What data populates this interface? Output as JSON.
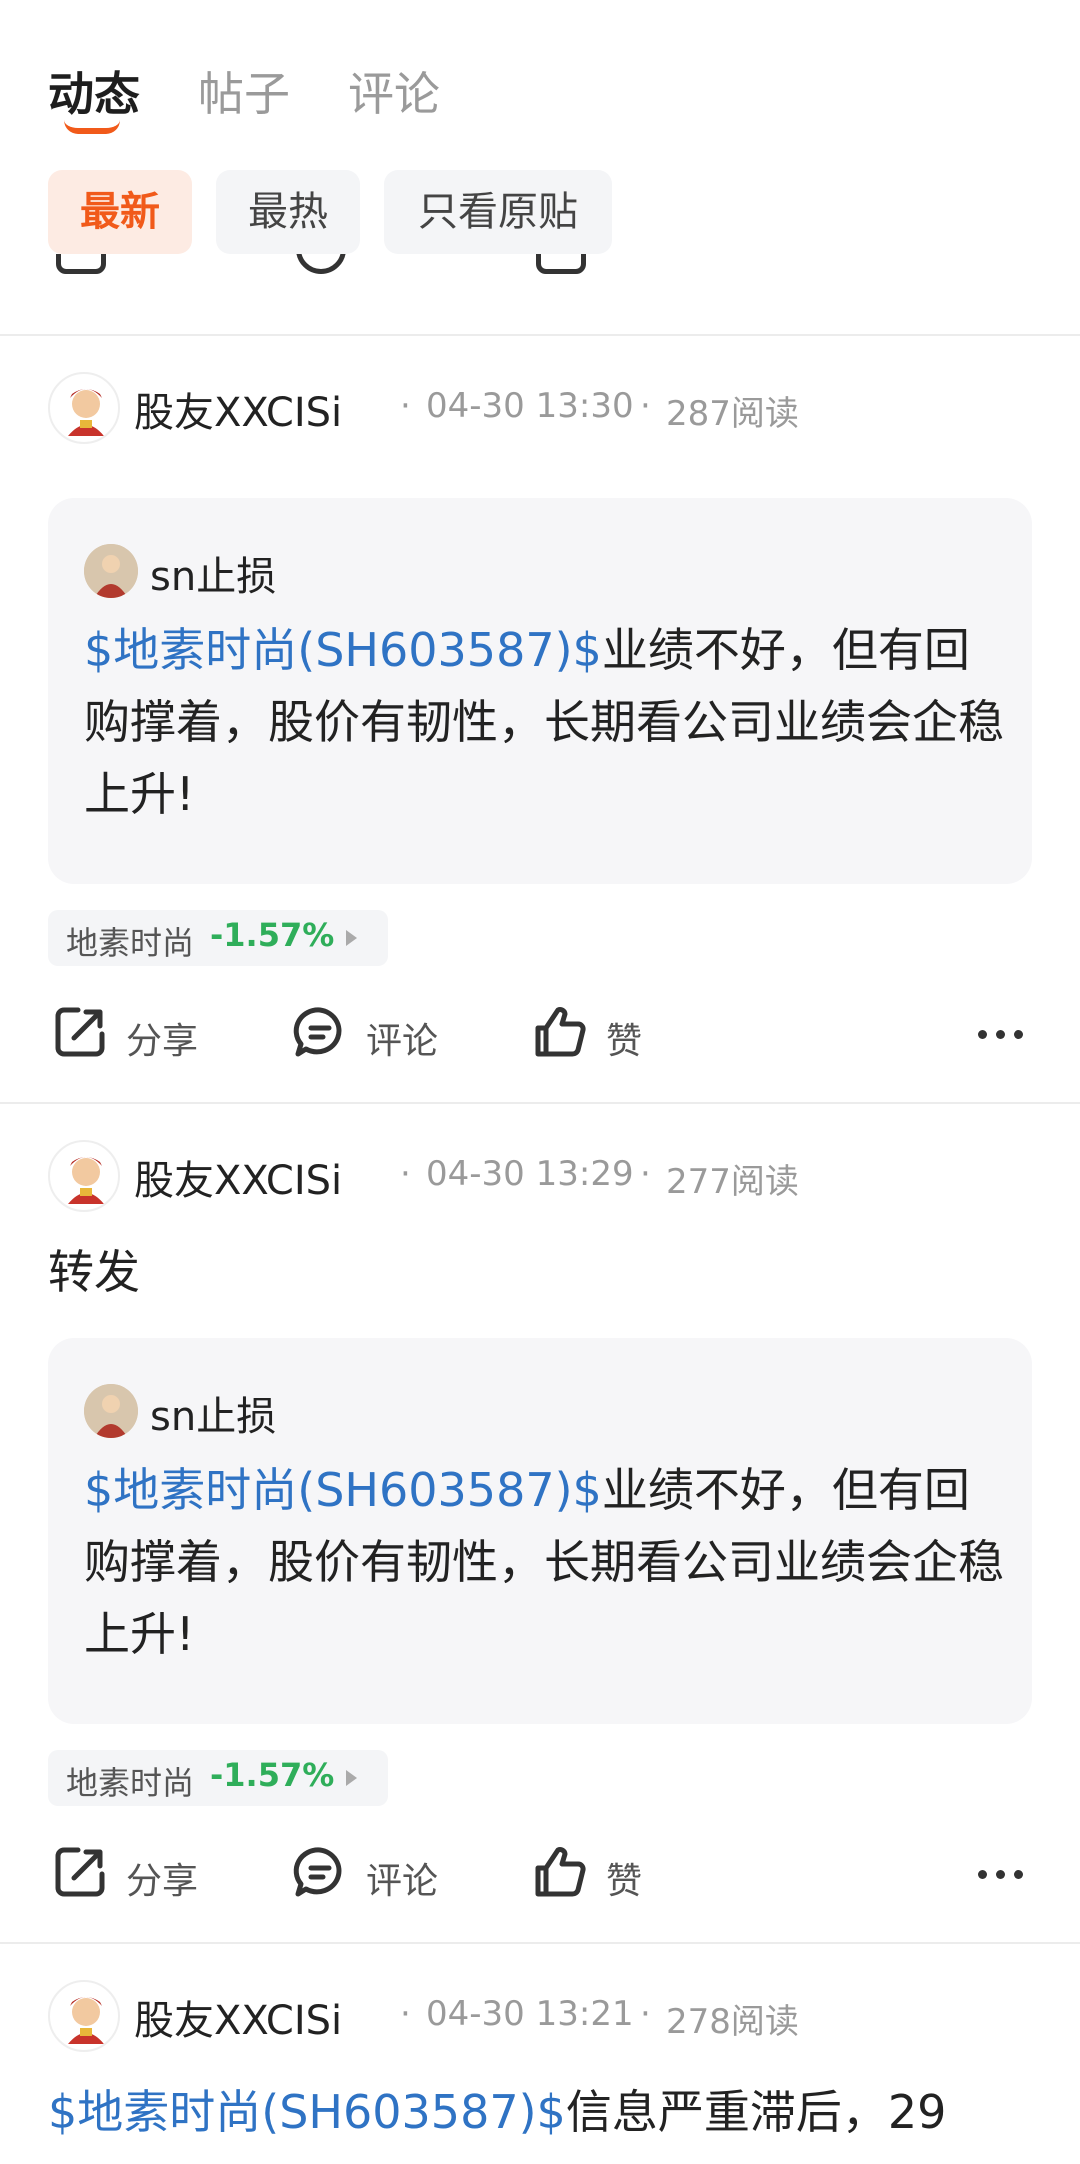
{
  "tabs": [
    {
      "label": "动态",
      "active": true
    },
    {
      "label": "帖子",
      "active": false
    },
    {
      "label": "评论",
      "active": false
    }
  ],
  "filters": [
    {
      "label": "最新",
      "active": true
    },
    {
      "label": "最热",
      "active": false
    },
    {
      "label": "只看原贴",
      "active": false
    }
  ],
  "actions": {
    "share": "分享",
    "comment": "评论",
    "like": "赞"
  },
  "posts": [
    {
      "user": "股友XXCISi",
      "time": "04-30 13:30",
      "reads": "287阅读",
      "quote": {
        "user": "sn止损",
        "stock_link": "$地素时尚(SH603587)$",
        "text": "业绩不好，但有回购撑着，股价有韧性，长期看公司业绩会企稳上升!"
      },
      "stock": {
        "name": "地素时尚",
        "change": "-1.57%"
      }
    },
    {
      "user": "股友XXCISi",
      "time": "04-30 13:29",
      "reads": "277阅读",
      "text": "转发",
      "quote": {
        "user": "sn止损",
        "stock_link": "$地素时尚(SH603587)$",
        "text": "业绩不好，但有回购撑着，股价有韧性，长期看公司业绩会企稳上升!"
      },
      "stock": {
        "name": "地素时尚",
        "change": "-1.57%"
      }
    },
    {
      "user": "股友XXCISi",
      "time": "04-30 13:21",
      "reads": "278阅读",
      "stock_link": "$地素时尚(SH603587)$",
      "text": "信息严重滞后，29"
    }
  ],
  "colors": {
    "accent": "#f15a1a",
    "link": "#2f73c4",
    "down": "#2fae5a"
  }
}
